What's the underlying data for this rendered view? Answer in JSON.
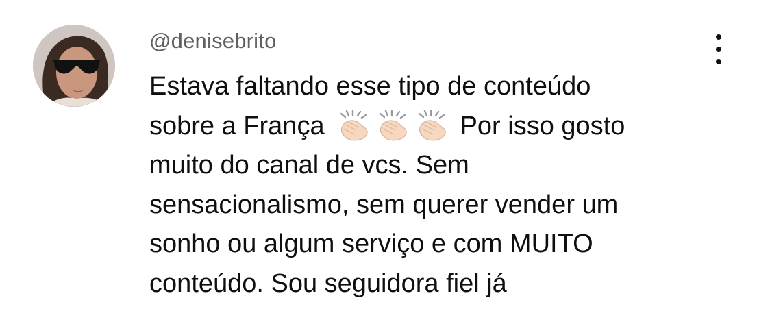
{
  "comment": {
    "author": "@denisebrito",
    "lines": {
      "l1": "Estava faltando esse tipo de conteúdo",
      "l2_before": "sobre a França",
      "l2_after": "Por isso gosto",
      "l3": "muito do canal de vcs. Sem",
      "l4": "sensacionalismo, sem querer vender um",
      "l5": "sonho ou algum serviço e com MUITO",
      "l6": "conteúdo. Sou seguidora fiel já"
    },
    "emoji": {
      "name": "clapping-hands-emoji",
      "count": 3,
      "skin_color": "#f7d7bd"
    },
    "menu_icon": "vertical-ellipsis-icon"
  },
  "colors": {
    "text": "#0f0f0f",
    "author": "#606060",
    "background": "#ffffff"
  }
}
